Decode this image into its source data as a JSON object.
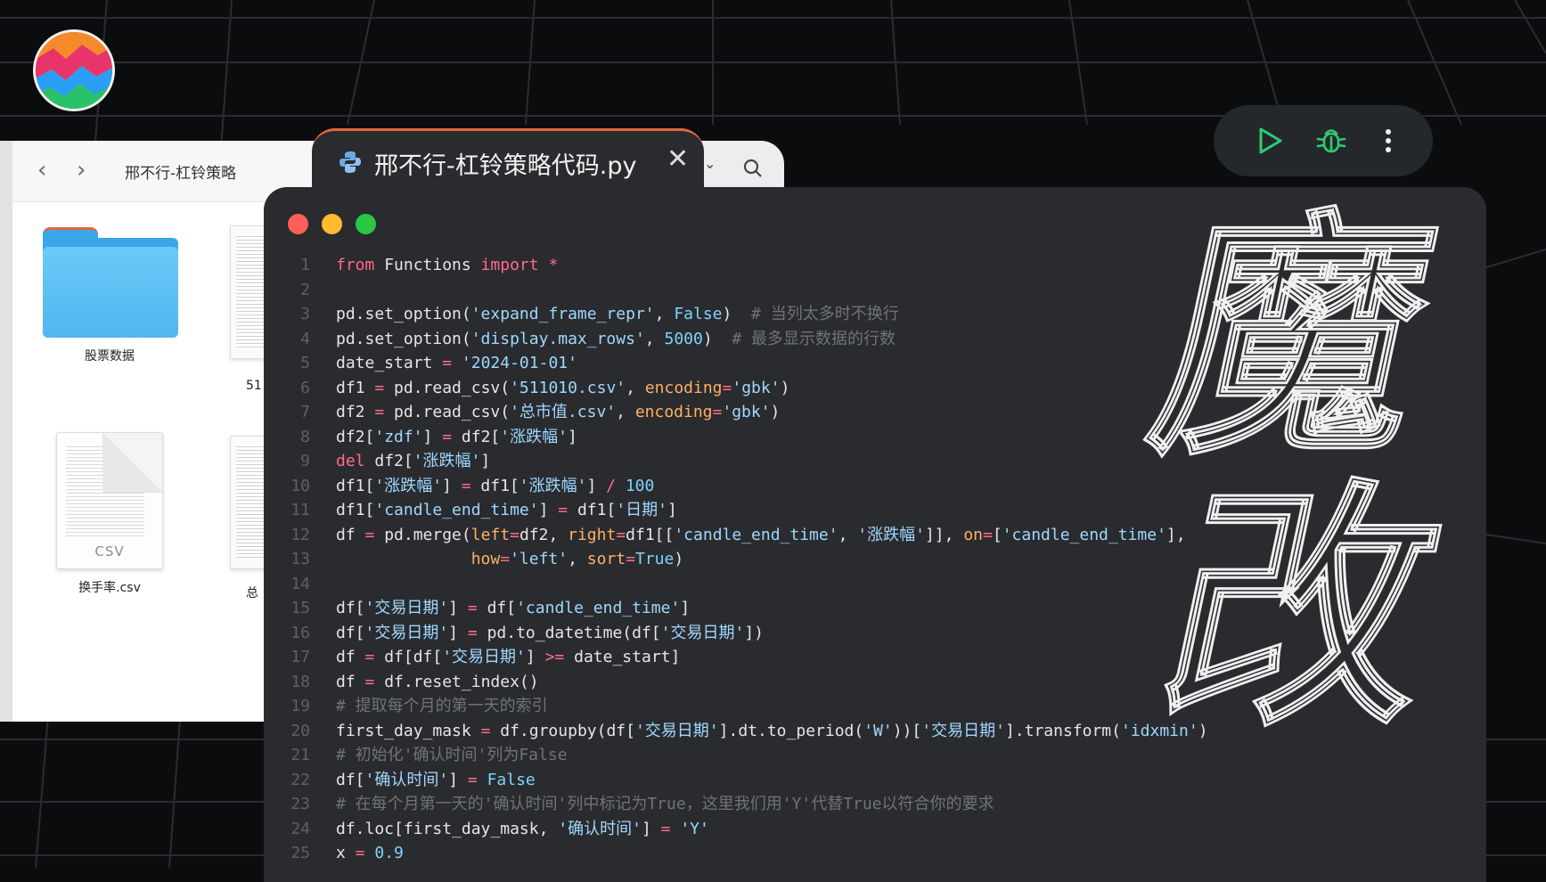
{
  "finder": {
    "back_icon": "chevron-left-icon",
    "forward_icon": "chevron-right-icon",
    "title": "邢不行-杠铃策略",
    "items": [
      {
        "name": "股票数据",
        "kind": "folder"
      },
      {
        "name": "换手率.csv",
        "kind": "csv",
        "badge": "CSV"
      },
      {
        "name": "51",
        "kind": "partial"
      },
      {
        "name": "总",
        "kind": "partial"
      }
    ]
  },
  "editor": {
    "tab_title": "邢不行-杠铃策略代码.py",
    "tab_close": "✕",
    "window_controls": {
      "close": "#ff5f57",
      "minimize": "#febc2e",
      "zoom": "#28c840"
    },
    "toolbar": {
      "run_icon": "play-icon",
      "debug_icon": "bug-icon",
      "more_icon": "more-vertical-icon",
      "accent": "#2ecc71"
    },
    "watermark": [
      "魔",
      "改"
    ],
    "line_numbers": [
      "1",
      "2",
      "3",
      "4",
      "5",
      "6",
      "7",
      "8",
      "9",
      "10",
      "11",
      "12",
      "13",
      "14",
      "15",
      "16",
      "17",
      "18",
      "19",
      "20",
      "21",
      "22",
      "23",
      "24",
      "25"
    ]
  }
}
